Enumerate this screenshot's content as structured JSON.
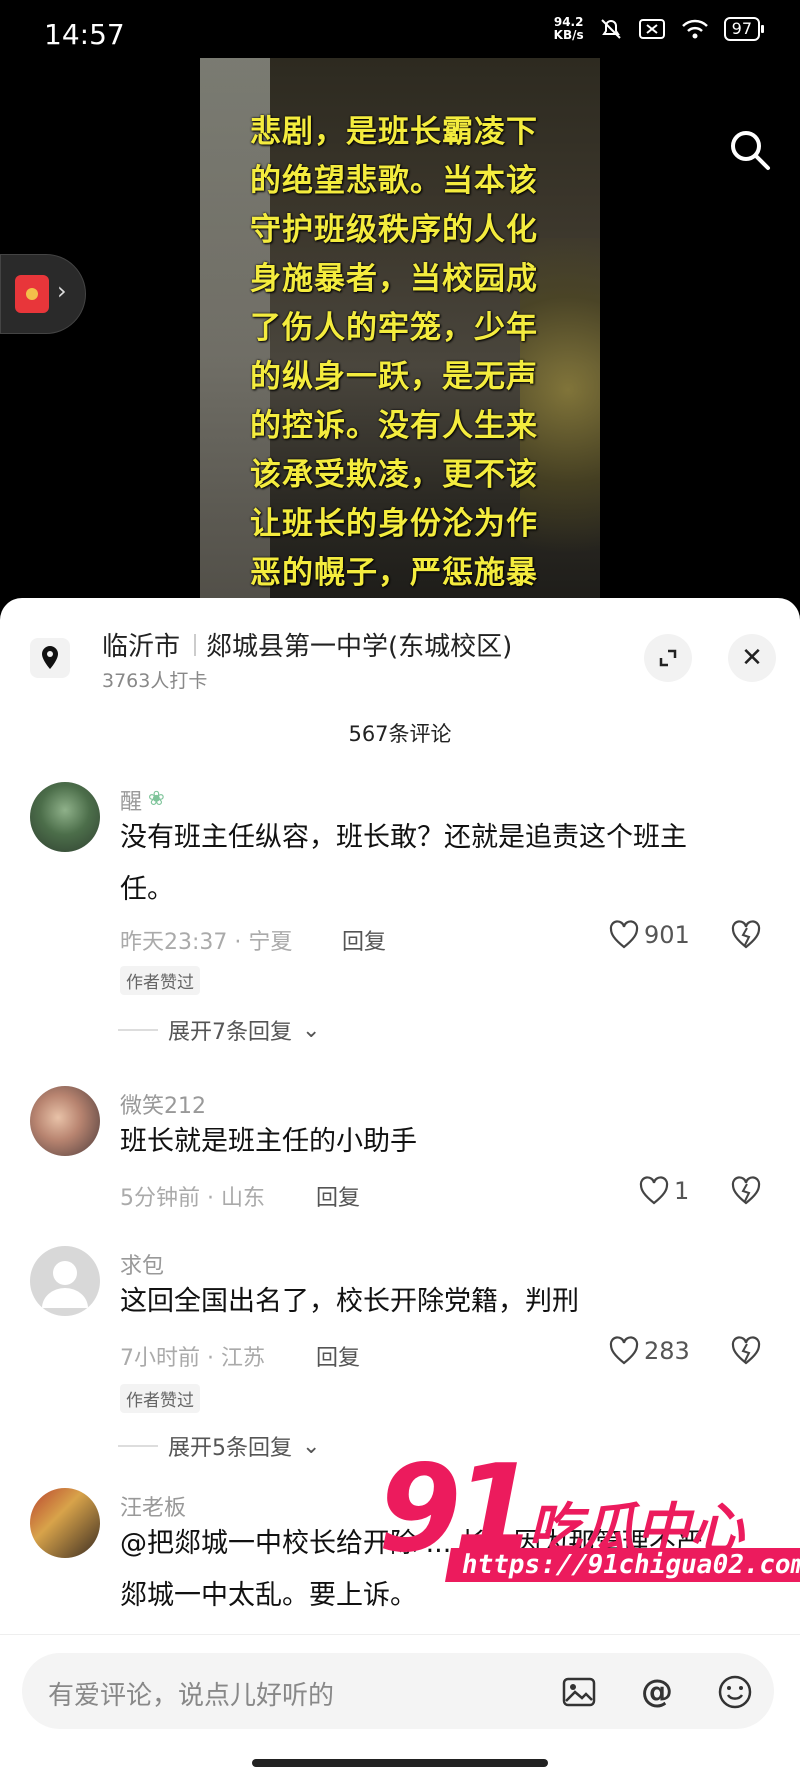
{
  "status_bar": {
    "time": "14:57",
    "net_speed_value": "94.2",
    "net_speed_unit": "KB/s",
    "battery": "97"
  },
  "video": {
    "overlay_text": "悲剧，是班长霸凌下的绝望悲歌。当本该守护班级秩序的人化身施暴者，当校园成了伤人的牢笼，少年的纵身一跃，是无声的控诉。没有人生来该承受欺凌，更不该让班长的身份沦为作恶的幌子，严惩施暴者，追责失职者，别让更多青春倒在黑暗"
  },
  "location": {
    "city": "临沂市",
    "school": "郯城县第一中学(东城校区)",
    "checkins": "3763人打卡"
  },
  "comments_count": "567条评论",
  "reply_label": "回复",
  "author_liked_label": "作者赞过",
  "comments": [
    {
      "name": "醒",
      "text": "没有班主任纵容，班长敢？还就是追责这个班主任。",
      "meta": "昨天23:37 · 宁夏",
      "likes": "901",
      "badge": "作者赞过",
      "expand": "展开7条回复"
    },
    {
      "name": "微笑212",
      "text": "班长就是班主任的小助手",
      "meta": "5分钟前 · 山东",
      "likes": "1"
    },
    {
      "name": "求包",
      "text": "这回全国出名了，校长开除党籍，判刑",
      "meta": "7小时前 · 江苏",
      "likes": "283",
      "badge": "作者赞过",
      "expand": "展开5条回复"
    },
    {
      "name": "汪老板",
      "text": "@把郯城一中校长给开除 ... 长，因为那管理不严，郯城一中太乱。要上诉。"
    }
  ],
  "watermark": {
    "number": "91",
    "brand": "吃瓜中心",
    "url": "https://91chigua02.com"
  },
  "input": {
    "placeholder": "有爱评论，说点儿好听的"
  },
  "colors": {
    "overlay_yellow": "#f4ec3e",
    "watermark_pink": "#ec1b5d"
  }
}
